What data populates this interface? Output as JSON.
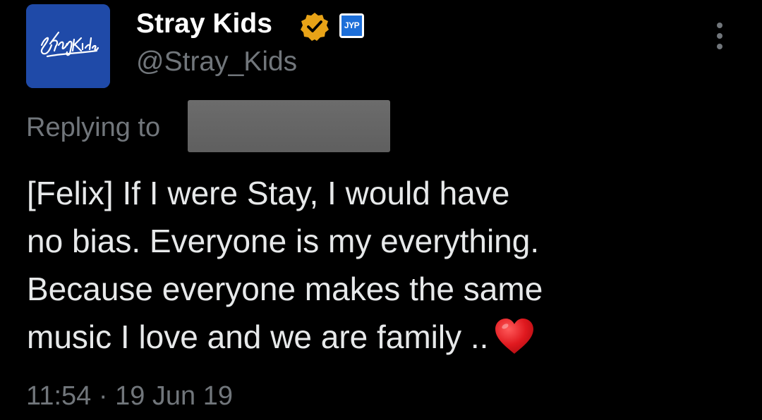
{
  "author": {
    "display_name": "Stray Kids",
    "handle": "@Stray_Kids",
    "avatar_logo_text": "Stray Kids",
    "verified_badge_color": "#e8a317",
    "affiliate_badge_text": "JYP",
    "avatar_color": "#1f4aa8"
  },
  "menu": {
    "icon": "more-vertical-icon"
  },
  "reply": {
    "label": "Replying to",
    "target_handle_redacted": true
  },
  "tweet": {
    "lines": [
      "[Felix] If I were Stay, I would have",
      "no bias. Everyone is my everything.",
      "Because everyone makes the same",
      "music I love and we are family .."
    ],
    "emoji": "heart-icon",
    "emoji_color": "#e0191f"
  },
  "meta": {
    "time": "11:54",
    "separator": "·",
    "date": "19 Jun 19"
  },
  "colors": {
    "background": "#000000",
    "primary_text": "#e7e9ea",
    "secondary_text": "#71767b"
  }
}
